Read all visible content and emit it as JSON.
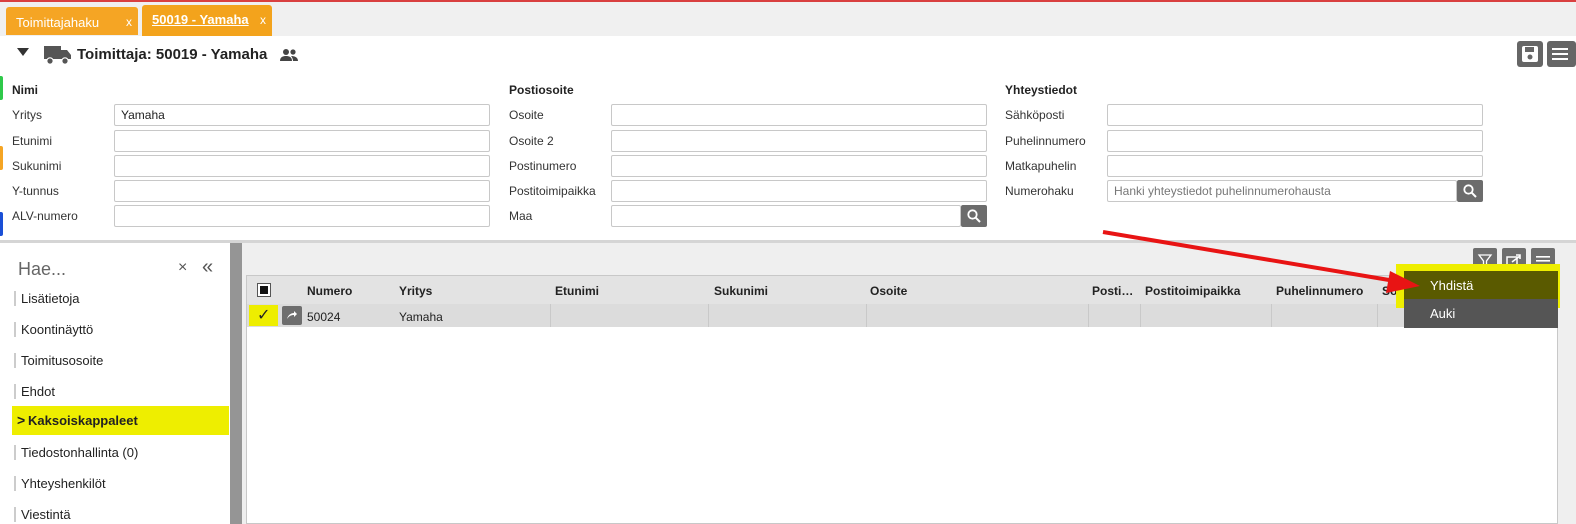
{
  "tabs": [
    {
      "label": "Toimittajahaku",
      "close": "x"
    },
    {
      "label": "50019 - Yamaha",
      "close": "x"
    }
  ],
  "header": {
    "title": "Toimittaja: 50019 - Yamaha"
  },
  "form": {
    "nimi": {
      "heading": "Nimi",
      "yritys_label": "Yritys",
      "yritys_value": "Yamaha",
      "etunimi_label": "Etunimi",
      "etunimi_value": "",
      "sukunimi_label": "Sukunimi",
      "sukunimi_value": "",
      "ytunnus_label": "Y-tunnus",
      "ytunnus_value": "",
      "alv_label": "ALV-numero",
      "alv_value": ""
    },
    "postiosoite": {
      "heading": "Postiosoite",
      "osoite_label": "Osoite",
      "osoite_value": "",
      "osoite2_label": "Osoite 2",
      "osoite2_value": "",
      "postinumero_label": "Postinumero",
      "postinumero_value": "",
      "postitoimipaikka_label": "Postitoimipaikka",
      "postitoimipaikka_value": "",
      "maa_label": "Maa",
      "maa_value": ""
    },
    "yhteystiedot": {
      "heading": "Yhteystiedot",
      "sahkoposti_label": "Sähköposti",
      "sahkoposti_value": "",
      "puhelinnumero_label": "Puhelinnumero",
      "puhelinnumero_value": "",
      "matkapuhelin_label": "Matkapuhelin",
      "matkapuhelin_value": "",
      "numerohaku_label": "Numerohaku",
      "numerohaku_placeholder": "Hanki yhteystiedot puhelinnumerohausta"
    }
  },
  "sidebar": {
    "search_placeholder": "Hae...",
    "clear": "×",
    "collapse": "«",
    "items": [
      {
        "label": "Lisätietoja"
      },
      {
        "label": "Koontinäyttö"
      },
      {
        "label": "Toimitusosoite"
      },
      {
        "label": "Ehdot"
      },
      {
        "label": "Kaksoiskappaleet",
        "active": true
      },
      {
        "label": "Tiedostonhallinta (0)"
      },
      {
        "label": "Yhteyshenkilöt"
      },
      {
        "label": "Viestintä"
      }
    ]
  },
  "grid": {
    "columns": [
      "Numero",
      "Yritys",
      "Etunimi",
      "Sukunimi",
      "Osoite",
      "Posti…",
      "Postitoimipaikka",
      "Puhelinnumero",
      "Soi"
    ],
    "rows": [
      {
        "numero": "50024",
        "yritys": "Yamaha",
        "selected": true,
        "check": "✓"
      }
    ]
  },
  "menu": {
    "items": [
      {
        "label": "Yhdistä",
        "highlighted": true
      },
      {
        "label": "Auki"
      }
    ]
  },
  "colors": {
    "tab": "#f5a524",
    "highlight": "#eeee00",
    "arrow": "#e81414",
    "button": "#6e6e6e"
  }
}
